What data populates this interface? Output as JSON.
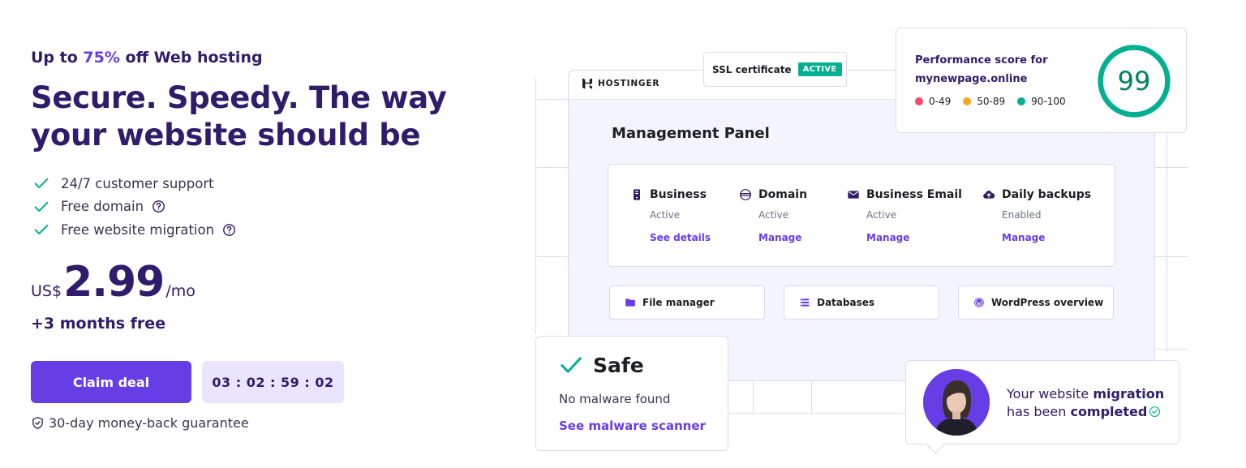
{
  "promo": {
    "eyebrow_prefix": "Up to",
    "eyebrow_discount": "75%",
    "eyebrow_suffix": "off Web hosting",
    "headline": "Secure. Speedy. The way your website should be",
    "features": [
      {
        "label": "24/7 customer support",
        "help": false
      },
      {
        "label": "Free domain",
        "help": true
      },
      {
        "label": "Free website migration",
        "help": true
      }
    ],
    "price": {
      "currency": "US$",
      "amount": "2.99",
      "period": "/mo"
    },
    "bonus": "+3 months free",
    "cta_label": "Claim deal",
    "countdown": "03 : 02 : 59 : 02",
    "guarantee": "30-day money-back guarantee"
  },
  "illustration": {
    "brand": "HOSTINGER",
    "ssl": {
      "label": "SSL certificate",
      "status": "ACTIVE"
    },
    "panel_title": "Management Panel",
    "services": [
      {
        "name": "Business",
        "status": "Active",
        "link": "See details",
        "icon": "server-icon"
      },
      {
        "name": "Domain",
        "status": "Active",
        "link": "Manage",
        "icon": "www-icon"
      },
      {
        "name": "Business Email",
        "status": "Active",
        "link": "Manage",
        "icon": "envelope-icon"
      },
      {
        "name": "Daily backups",
        "status": "Enabled",
        "link": "Manage",
        "icon": "cloud-upload-icon"
      }
    ],
    "tools": [
      {
        "label": "File manager",
        "icon": "folder-icon"
      },
      {
        "label": "Databases",
        "icon": "list-icon"
      },
      {
        "label": "WordPress overview",
        "icon": "wordpress-icon"
      }
    ],
    "performance": {
      "title_line1": "Performance score for",
      "title_line2": "mynewpage.online",
      "score": "99",
      "score_fraction": 0.99,
      "legend": [
        {
          "range": "0-49",
          "color": "#f2496a"
        },
        {
          "range": "50-89",
          "color": "#ffa326"
        },
        {
          "range": "90-100",
          "color": "#00b090"
        }
      ]
    },
    "security": {
      "title": "Safe",
      "description": "No malware found",
      "link": "See malware scanner"
    },
    "migration": {
      "line1_prefix": "Your website",
      "line1_bold": "migration",
      "line2_prefix": "has been",
      "line2_bold": "completed"
    }
  },
  "colors": {
    "brand": "#673de6",
    "navy": "#2f1c6a",
    "success": "#00b090",
    "score_text": "#008361"
  }
}
